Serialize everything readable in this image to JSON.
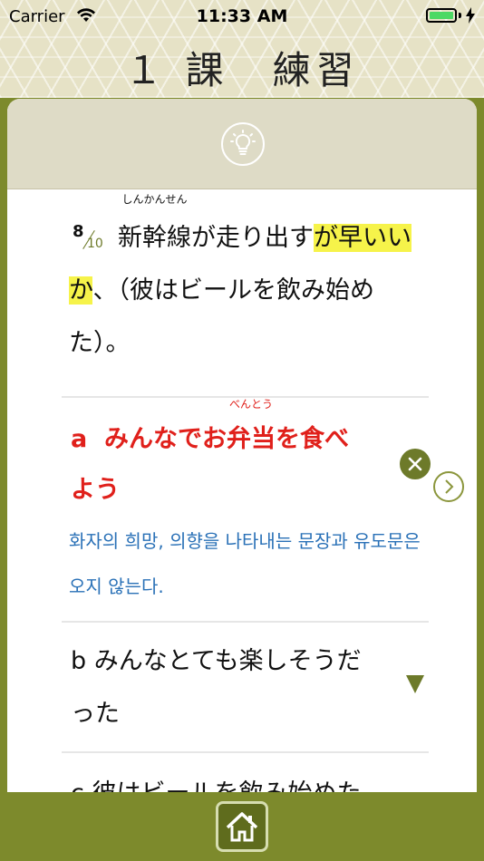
{
  "status_bar": {
    "carrier": "Carrier",
    "time": "11:33 AM",
    "battery_level": 1.0
  },
  "header": {
    "title": "１ 課　練習"
  },
  "hint": {
    "icon": "lightbulb-icon"
  },
  "question": {
    "number": "8",
    "total": "10",
    "part1": "",
    "word": "新幹線",
    "furigana": "しんかんせん",
    "part2": "が走り出す",
    "highlight_1": "が早い",
    "break": "か",
    "part3": "、（彼はビールを飲み始めた）。"
  },
  "options": {
    "a": {
      "letter": "a",
      "pre": "みんなでお",
      "word": "弁当",
      "furigana": "べんとう",
      "post": "を食べよう",
      "color": "#e0201b",
      "status_icon": "close-circle-icon",
      "explanation": "화자의 희망, 의향을 나타내는 문장과 유도문은 오지 않는다."
    },
    "b": {
      "letter": "b",
      "text": "みんなとても楽しそうだった",
      "expand_icon": "triangle-down-icon"
    },
    "c": {
      "letter": "c",
      "text": "彼はビールを飲み始めた"
    }
  },
  "navigation": {
    "next_icon": "chevron-right-icon",
    "home_icon": "home-icon"
  },
  "colors": {
    "accent": "#7d8a2c",
    "highlight": "#f6f34a",
    "explanation": "#2a71b7"
  }
}
